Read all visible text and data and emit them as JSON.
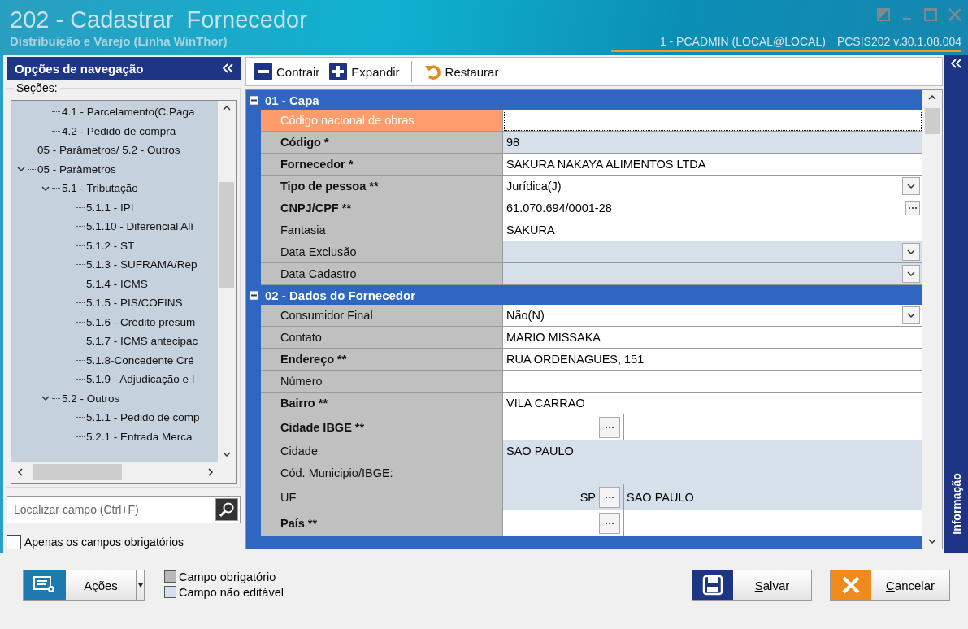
{
  "window": {
    "title": "202 - Cadastrar  Fornecedor",
    "subtitle": "Distribuição e Varejo (Linha WinThor)",
    "session": "1 - PCADMIN (LOCAL@LOCAL)",
    "program": "PCSIS202  v.30.1.08.004"
  },
  "navigation": {
    "title": "Opções de navegação",
    "sections_label": "Seções:",
    "tree": [
      {
        "children": [
          {
            "label": "4.1 - Parcelamento(C.Paga"
          },
          {
            "label": "4.2 - Pedido de compra"
          }
        ]
      },
      {
        "label": "05 - Parâmetros/ 5.2 - Outros"
      },
      {
        "label": "05 - Parâmetros",
        "expanded": true,
        "children": [
          {
            "label": "5.1 - Tributação",
            "expanded": true,
            "children": [
              {
                "label": "5.1.1 - IPI"
              },
              {
                "label": "5.1.10 - Diferencial Alí"
              },
              {
                "label": "5.1.2 - ST"
              },
              {
                "label": "5.1.3 - SUFRAMA/Rep"
              },
              {
                "label": "5.1.4 - ICMS"
              },
              {
                "label": "5.1.5 - PIS/COFINS"
              },
              {
                "label": "5.1.6 - Crédito presum"
              },
              {
                "label": "5.1.7 - ICMS antecipac"
              },
              {
                "label": "5.1.8-Concedente Cré"
              },
              {
                "label": "5.1.9 - Adjudicação e I"
              }
            ]
          },
          {
            "label": "5.2 - Outros",
            "expanded": true,
            "children": [
              {
                "label": "5.1.1 - Pedido de comp"
              },
              {
                "label": "5.2.1 - Entrada Merca"
              }
            ]
          }
        ]
      }
    ],
    "search": {
      "placeholder": "Localizar campo (Ctrl+F)"
    },
    "required_only": {
      "label": "Apenas os campos obrigatórios",
      "checked": false
    }
  },
  "toolbar": [
    {
      "kind": "collapse",
      "label": "Contrair"
    },
    {
      "kind": "expand",
      "label": "Expandir"
    },
    {
      "kind": "restore",
      "label": "Restaurar"
    }
  ],
  "grid": {
    "sections": [
      {
        "title": "01 - Capa",
        "expanded": true,
        "rows": [
          {
            "kind": "text",
            "label": "Código nacional de obras",
            "required": false,
            "editable": true,
            "focused": true
          },
          {
            "kind": "text",
            "label": "Código *",
            "required": true,
            "editable": false,
            "focused": false,
            "value": "98"
          },
          {
            "kind": "text",
            "label": "Fornecedor *",
            "required": true,
            "editable": true,
            "focused": false,
            "value": "SAKURA NAKAYA ALIMENTOS LTDA"
          },
          {
            "kind": "dropdown",
            "label": "Tipo de pessoa **",
            "required": true,
            "editable": true,
            "focused": false,
            "value": "Jurídica(J)"
          },
          {
            "kind": "ellipsis",
            "label": "CNPJ/CPF **",
            "required": true,
            "editable": true,
            "focused": false,
            "value": "61.070.694/0001-28"
          },
          {
            "kind": "text",
            "label": "Fantasia",
            "required": false,
            "editable": true,
            "focused": false,
            "value": "SAKURA"
          },
          {
            "kind": "dropdown",
            "label": "Data Exclusão",
            "required": false,
            "editable": false,
            "focused": false
          },
          {
            "kind": "dropdown",
            "label": "Data Cadastro",
            "required": false,
            "editable": false,
            "focused": false
          }
        ]
      },
      {
        "title": "02 - Dados do Fornecedor",
        "expanded": true,
        "rows": [
          {
            "kind": "dropdown",
            "label": "Consumidor Final",
            "required": false,
            "editable": true,
            "focused": false,
            "value": "Não(N)"
          },
          {
            "kind": "text",
            "label": "Contato",
            "required": false,
            "editable": true,
            "focused": false,
            "value": "MARIO MISSAKA"
          },
          {
            "kind": "text",
            "label": "Endereço **",
            "required": true,
            "editable": true,
            "focused": false,
            "value": "RUA ORDENAGUES, 151"
          },
          {
            "kind": "text",
            "label": "Número",
            "required": false,
            "editable": true,
            "focused": false
          },
          {
            "kind": "text",
            "label": "Bairro **",
            "required": true,
            "editable": true,
            "focused": false,
            "value": "VILA CARRAO"
          },
          {
            "kind": "lookup",
            "label": "Cidade IBGE **",
            "required": true,
            "editable": true,
            "focused": false
          },
          {
            "kind": "text",
            "label": "Cidade",
            "required": false,
            "editable": false,
            "focused": false,
            "value": "SAO PAULO"
          },
          {
            "kind": "text",
            "label": "Cód. Municipio/IBGE:",
            "required": false,
            "editable": false,
            "focused": false
          },
          {
            "kind": "lookup",
            "label": "UF",
            "required": false,
            "editable": false,
            "focused": false,
            "code": "SP",
            "description": "SAO PAULO"
          },
          {
            "kind": "lookup",
            "label": "País **",
            "required": true,
            "editable": true,
            "focused": false
          }
        ]
      }
    ]
  },
  "info_panel": {
    "title": "Informação"
  },
  "footer": {
    "actions": "Ações",
    "legend": [
      {
        "kind": "required",
        "label": "Campo obrigatório"
      },
      {
        "kind": "readonly",
        "label": "Campo não editável"
      }
    ],
    "buttons": [
      {
        "kind": "save",
        "label": "Salvar"
      },
      {
        "kind": "cancel",
        "label": "Cancelar"
      }
    ]
  }
}
